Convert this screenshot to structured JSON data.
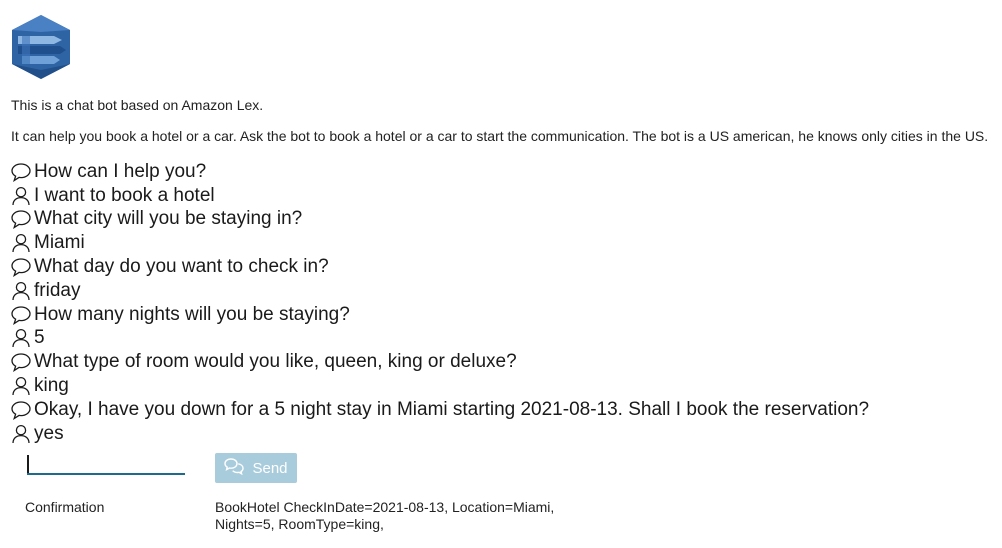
{
  "intro": {
    "line1": "This is a chat bot based on Amazon Lex.",
    "line2": "It can help you book a hotel or a car. Ask the bot to book a hotel or a car to start the communication. The bot is a US american, he knows only cities in the US."
  },
  "conversation": [
    {
      "role": "bot",
      "icon": "speech-bubble-icon",
      "text": "How can I help you?"
    },
    {
      "role": "user",
      "icon": "user-icon",
      "text": "I want to book a hotel"
    },
    {
      "role": "bot",
      "icon": "speech-bubble-icon",
      "text": "What city will you be staying in?"
    },
    {
      "role": "user",
      "icon": "user-icon",
      "text": "Miami"
    },
    {
      "role": "bot",
      "icon": "speech-bubble-icon",
      "text": "What day do you want to check in?"
    },
    {
      "role": "user",
      "icon": "user-icon",
      "text": "friday"
    },
    {
      "role": "bot",
      "icon": "speech-bubble-icon",
      "text": "How many nights will you be staying?"
    },
    {
      "role": "user",
      "icon": "user-icon",
      "text": "5"
    },
    {
      "role": "bot",
      "icon": "speech-bubble-icon",
      "text": "What type of room would you like, queen, king or deluxe?"
    },
    {
      "role": "user",
      "icon": "user-icon",
      "text": "king"
    },
    {
      "role": "bot",
      "icon": "speech-bubble-icon",
      "text": "Okay, I have you down for a 5 night stay in Miami starting 2021-08-13. Shall I book the reservation?"
    },
    {
      "role": "user",
      "icon": "user-icon",
      "text": "yes"
    }
  ],
  "input": {
    "value": "",
    "placeholder": ""
  },
  "send_button": {
    "label": "Send",
    "icon": "chat-bubbles-icon"
  },
  "confirmation": {
    "label": "Confirmation",
    "value": "BookHotel CheckInDate=2021-08-13, Location=Miami, Nights=5, RoomType=king,"
  },
  "colors": {
    "accent": "#1c6b8c",
    "button_disabled": "#a8ccdc",
    "logo_dark": "#2e63a4",
    "logo_light": "#5c93d1"
  }
}
